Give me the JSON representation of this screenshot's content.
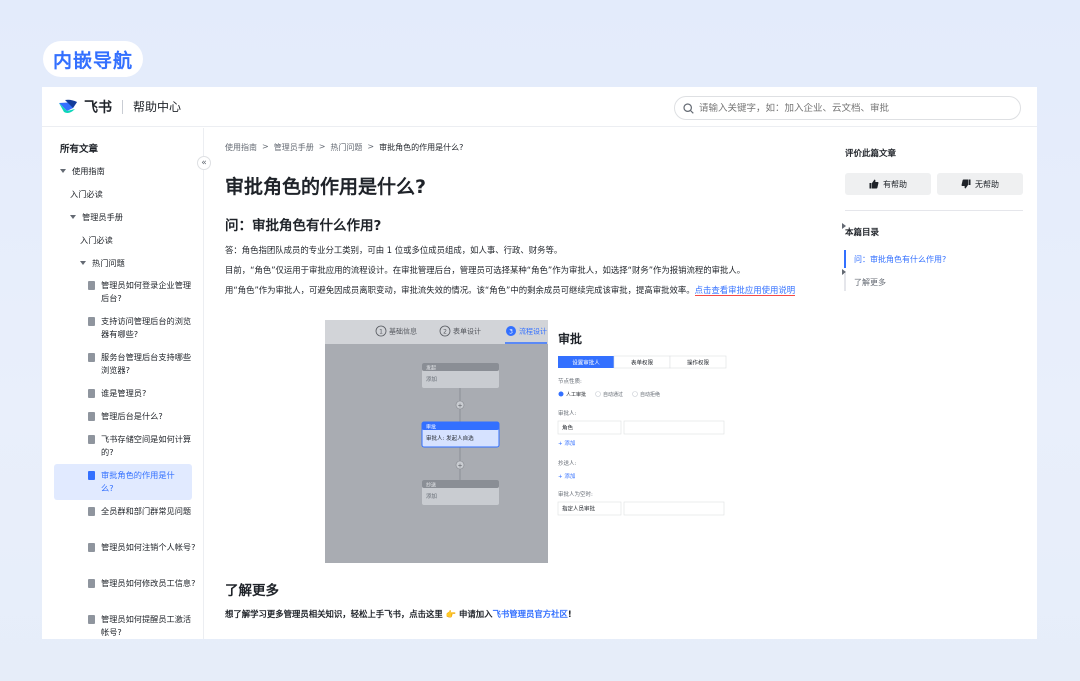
{
  "badge": "内嵌导航",
  "header": {
    "brand": "飞书",
    "help_center": "帮助中心",
    "search_placeholder": "请输入关键字，如：加入企业、云文档、审批"
  },
  "sidebar": {
    "title": "所有文章",
    "collapse_glyph": "«",
    "tree": [
      {
        "label": "使用指南"
      },
      {
        "label": "入门必读"
      },
      {
        "label": "管理员手册"
      },
      {
        "label": "入门必读"
      },
      {
        "label": "热门问题"
      }
    ],
    "docs": [
      "管理员如何登录企业管理后台?",
      "支持访问管理后台的浏览器有哪些?",
      "服务台管理后台支持哪些浏览器?",
      "谁是管理员?",
      "管理后台是什么?",
      "飞书存储空间是如何计算的?",
      "审批角色的作用是什么?",
      "全员群和部门群常见问题",
      "管理员如何注销个人帐号?",
      "管理员如何修改员工信息?",
      "管理员如何提醒员工激活帐号?"
    ]
  },
  "main": {
    "breadcrumbs": [
      "使用指南",
      "管理员手册",
      "热门问题",
      "审批角色的作用是什么?"
    ],
    "crumb_sep": ">",
    "title": "审批角色的作用是什么?",
    "q_heading": "问：审批角色有什么作用?",
    "para1": "答：角色指团队成员的专业分工类别，可由 1 位或多位成员组成，如人事、行政、财务等。",
    "para2": "目前，“角色”仅运用于审批应用的流程设计。在审批管理后台，管理员可选择某种“角色”作为审批人，如选择“财务”作为报销流程的审批人。",
    "para3": "用“角色”作为审批人，可避免因成员离职变动，审批流失效的情况。该“角色”中的剩余成员可继续完成该审批，提高审批效率。",
    "para3_link": "点击查看审批应用使用说明",
    "learn_heading": "了解更多",
    "learn_text": "想了解学习更多管理员相关知识，轻松上手飞书，点击这里 👉 申请加入",
    "learn_link": "飞书管理员官方社区",
    "learn_end": "!"
  },
  "screenshot": {
    "steps": [
      "基础信息",
      "表单设计",
      "流程设计"
    ],
    "step_nums": [
      "1",
      "2",
      "3"
    ],
    "node_start_title": "发起",
    "node_start_body": "添加",
    "node_approve_title": "审批",
    "node_approve_body": "审批人: 发起人自选",
    "node_cc_title": "抄送",
    "node_cc_body": "添加",
    "panel_title": "审批",
    "tabs": [
      "设置审批人",
      "表单权限",
      "操作权限"
    ],
    "node_prop_label": "节点性质:",
    "radios": [
      "人工审批",
      "自动通过",
      "自动拒绝"
    ],
    "approver_label": "审批人:",
    "approver_type": "角色",
    "add_label": "+ 添加",
    "cc_label": "抄送人:",
    "empty_label": "审批人为空时:",
    "empty_value": "指定人员审批"
  },
  "right": {
    "rate_title": "评价此篇文章",
    "helpful": "有帮助",
    "unhelpful": "无帮助",
    "toc_title": "本篇目录",
    "toc": [
      "问：审批角色有什么作用?",
      "了解更多"
    ]
  },
  "colors": {
    "accent": "#3370ff",
    "link_underline": "#f54a45"
  }
}
